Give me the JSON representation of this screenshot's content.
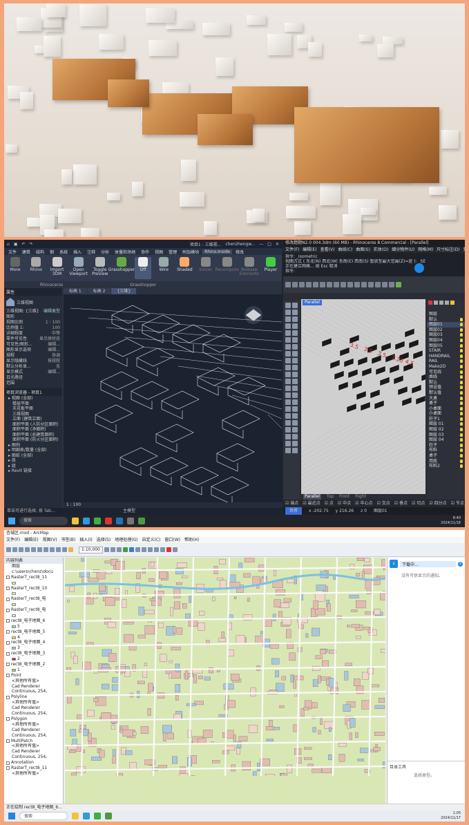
{
  "revit": {
    "menu": [
      "文件",
      "建筑",
      "结构",
      "钢",
      "系统",
      "插入",
      "注释",
      "分析",
      "体量和场地",
      "协作",
      "视图",
      "管理",
      "附加模块",
      "Rhino.Inside",
      "修改"
    ],
    "title": "项目1 - 三维视...",
    "user": "chenzhengw...",
    "ribbon_tabs": [
      "文件",
      "建筑",
      "结构",
      "钢",
      "系统",
      "插入",
      "注释",
      "分析",
      "体量和场地",
      "协作",
      "视图",
      "管理",
      "附加模块",
      "Rhino.Inside",
      "修改"
    ],
    "ribbon_buttons": [
      "More",
      "Rhino",
      "Import 3DM",
      "Open Viewport",
      "Toggle Preview",
      "Grasshopper",
      "Off",
      "Wire",
      "Shaded",
      "Solver",
      "Recompute",
      "Release Elements",
      "Player"
    ],
    "ribbon_groups": [
      "Rhinoceros",
      "Grasshopper"
    ],
    "properties_title": "属性",
    "view_type": "三维视图",
    "view_dropdown": "三维视图: {三维}",
    "edit_type": "编辑类型",
    "properties": [
      {
        "k": "图形",
        "v": ""
      },
      {
        "k": "视图比例",
        "v": "1 : 100"
      },
      {
        "k": "比例值 1:",
        "v": "100"
      },
      {
        "k": "详细程度",
        "v": "中等"
      },
      {
        "k": "零件可见性",
        "v": "显示原状态"
      },
      {
        "k": "可见性/图形...",
        "v": "编辑..."
      },
      {
        "k": "图形显示选项",
        "v": "编辑..."
      },
      {
        "k": "规程",
        "v": "协调"
      },
      {
        "k": "显示隐藏线",
        "v": "按规程"
      },
      {
        "k": "默认分析显...",
        "v": "无"
      },
      {
        "k": "显示模式",
        "v": "编辑..."
      },
      {
        "k": "日光路径",
        "v": ""
      },
      {
        "k": "范围",
        "v": ""
      }
    ],
    "browser_title": "项目浏览器 - 项目1",
    "browser": [
      {
        "t": "视图 (全部)",
        "l": 1
      },
      {
        "t": "楼层平面",
        "l": 2
      },
      {
        "t": "天花板平面",
        "l": 2
      },
      {
        "t": "三维视图",
        "l": 2
      },
      {
        "t": "立面 (建筑立面)",
        "l": 2
      },
      {
        "t": "面积平面 (人防分区面积)",
        "l": 2
      },
      {
        "t": "面积平面 (净面积)",
        "l": 2
      },
      {
        "t": "面积平面 (总建筑面积)",
        "l": 2
      },
      {
        "t": "面积平面 (防火分区面积)",
        "l": 2
      },
      {
        "t": "图例",
        "l": 1
      },
      {
        "t": "明细表/数量 (全部)",
        "l": 1
      },
      {
        "t": "图纸 (全部)",
        "l": 1
      },
      {
        "t": "族",
        "l": 1
      },
      {
        "t": "组",
        "l": 1
      },
      {
        "t": "Revit 链接",
        "l": 1
      }
    ],
    "view_tabs": [
      "标高 1",
      "标高 2",
      "{三维}"
    ],
    "scale": "1 : 100",
    "status": "单击可进行选择; 按 Tab...",
    "status_right": "主模型"
  },
  "rhino": {
    "title": "修改题题N2.0 004.3dm (60 MB) - Rhinoceros 8 Commercial - [Parallel]",
    "menu": [
      "文件(F)",
      "编辑(E)",
      "查看(V)",
      "曲线(C)",
      "曲面(S)",
      "实体(O)",
      "细分物件(U)",
      "网格(M)",
      "尺寸标注(D)",
      "变动(T)",
      "工具(L)",
      "分析(A)",
      "渲染(R)",
      "面板(P)",
      "说明(H)"
    ],
    "cmd_lines": [
      "指令: _Isometric",
      "视图方式 ( 东北(N) 西北(W) 东南(E) 西南(S) 暂放至最大范围(Z)=是 ): _SE",
      "正在建立网格... 按 Esc 取消",
      "指令:"
    ],
    "viewport": "Parallel",
    "viewport_tabs": [
      "Parallel",
      "Top",
      "Front",
      "Right"
    ],
    "annotations": [
      "3.5",
      "3.5",
      "3.5",
      "1.15",
      "4.5"
    ],
    "layers_title": "图层",
    "layers": [
      {
        "n": "默认",
        "sel": false
      },
      {
        "n": "图层01",
        "sel": true
      },
      {
        "n": "图层02",
        "sel": false
      },
      {
        "n": "图层03",
        "sel": false
      },
      {
        "n": "图层04",
        "sel": false
      },
      {
        "n": "图层05",
        "sel": false
      },
      {
        "n": "STAIR",
        "sel": false
      },
      {
        "n": "HANDRAIL",
        "sel": false
      },
      {
        "n": "RAIL",
        "sel": false
      },
      {
        "n": "Make2D",
        "sel": false
      },
      {
        "n": "可见线",
        "sel": false
      },
      {
        "n": "曲线",
        "sel": false
      },
      {
        "n": "默认",
        "sel": false
      },
      {
        "n": "预设值",
        "sel": false
      },
      {
        "n": "默认值",
        "sel": false
      },
      {
        "n": "大桌",
        "sel": false
      },
      {
        "n": "桌子",
        "sel": false
      },
      {
        "n": "小桌面",
        "sel": false
      },
      {
        "n": "小桌面",
        "sel": false
      },
      {
        "n": "柱子1",
        "sel": false
      },
      {
        "n": "图层 01",
        "sel": false
      },
      {
        "n": "图层 02",
        "sel": false
      },
      {
        "n": "图层 03",
        "sel": false
      },
      {
        "n": "图层 04",
        "sel": false
      },
      {
        "n": "柱子",
        "sel": false
      },
      {
        "n": "布料",
        "sel": false
      },
      {
        "n": "桌子",
        "sel": false
      },
      {
        "n": "用底",
        "sel": false
      },
      {
        "n": "布料2",
        "sel": false
      }
    ],
    "osnap": [
      "端点",
      "最近点",
      "点",
      "中点",
      "中心点",
      "交点",
      "垂点",
      "切点",
      "四分点",
      "节点",
      "顶点",
      "投影",
      "停用"
    ],
    "status": [
      "世界",
      "x -202.75",
      "y 216.26",
      "z 0",
      "图层01"
    ]
  },
  "taskbar_top": {
    "search": "搜索",
    "time": "8:40",
    "date": "2024/11/18"
  },
  "arcmap": {
    "title": "杏城区.mxd - ArcMap",
    "menu": [
      "文件(F)",
      "编辑(E)",
      "视图(V)",
      "书签(B)",
      "插入(I)",
      "选择(S)",
      "地理处理(G)",
      "自定义(C)",
      "窗口(W)",
      "帮助(H)"
    ],
    "scale": "1:10,000",
    "toc_title": "内容列表",
    "toc": [
      {
        "t": "图层",
        "cb": false,
        "sw": ""
      },
      {
        "t": "c:\\users\\chenz\\docu",
        "cb": false,
        "sw": ""
      },
      {
        "t": "RasterT_rect8_11",
        "cb": true,
        "sw": ""
      },
      {
        "t": "",
        "cb": false,
        "sw": "#f0e6a0"
      },
      {
        "t": "RasterT_rect8_10",
        "cb": true,
        "sw": ""
      },
      {
        "t": "",
        "cb": false,
        "sw": "#e9e9b0"
      },
      {
        "t": "RasterT_rect8_电",
        "cb": true,
        "sw": ""
      },
      {
        "t": "",
        "cb": false,
        "sw": "#f7d6c4"
      },
      {
        "t": "RasterT_rect8_电",
        "cb": true,
        "sw": ""
      },
      {
        "t": "",
        "cb": false,
        "sw": "#cfe6f2"
      },
      {
        "t": "rect8_电子地图_6",
        "cb": true,
        "sw": ""
      },
      {
        "t": "5",
        "cb": false,
        "sw": "#8fd0e8"
      },
      {
        "t": "rect8_电子地图_5",
        "cb": true,
        "sw": ""
      },
      {
        "t": "4",
        "cb": false,
        "sw": "#e6d24a"
      },
      {
        "t": "rect8_电子地图_4",
        "cb": true,
        "sw": ""
      },
      {
        "t": "3",
        "cb": false,
        "sw": "#a7c7e7"
      },
      {
        "t": "rect8_电子地图_3",
        "cb": true,
        "sw": ""
      },
      {
        "t": "2",
        "cb": false,
        "sw": "#c2195b"
      },
      {
        "t": "rect8_电子地图_2",
        "cb": true,
        "sw": ""
      },
      {
        "t": "1",
        "cb": false,
        "sw": "#9fd07a"
      },
      {
        "t": "Point",
        "cb": true,
        "sw": ""
      },
      {
        "t": "<其他所有值>",
        "cb": false,
        "sw": ""
      },
      {
        "t": "Cad Renderer",
        "cb": false,
        "sw": ""
      },
      {
        "t": "Continuous, 254,",
        "cb": false,
        "sw": ""
      },
      {
        "t": "Polyline",
        "cb": true,
        "sw": ""
      },
      {
        "t": "<其他所有值>",
        "cb": false,
        "sw": ""
      },
      {
        "t": "Cad Renderer",
        "cb": false,
        "sw": ""
      },
      {
        "t": "Continuous, 254,",
        "cb": false,
        "sw": ""
      },
      {
        "t": "Polygon",
        "cb": true,
        "sw": ""
      },
      {
        "t": "<其他所有值>",
        "cb": false,
        "sw": ""
      },
      {
        "t": "Cad Renderer",
        "cb": false,
        "sw": ""
      },
      {
        "t": "Continuous, 254,",
        "cb": false,
        "sw": ""
      },
      {
        "t": "MultiPatch",
        "cb": true,
        "sw": ""
      },
      {
        "t": "<其他所有值>",
        "cb": false,
        "sw": ""
      },
      {
        "t": "Cad Renderer",
        "cb": false,
        "sw": ""
      },
      {
        "t": "Continuous, 254,",
        "cb": false,
        "sw": ""
      },
      {
        "t": "Annotation",
        "cb": true,
        "sw": ""
      },
      {
        "t": "RasterT_rect8_11",
        "cb": true,
        "sw": ""
      },
      {
        "t": "<其他所有值>",
        "cb": false,
        "sw": ""
      }
    ],
    "right_panel": {
      "tab": "下载中...",
      "badge": "2",
      "msg": "没有可供显示的通知。",
      "tool_title": "目录工具",
      "tool_msg": "选择类型。"
    },
    "status": "正在绘制 rect8_电子地图_6..."
  },
  "taskbar_bottom": {
    "search": "搜索",
    "time": "1:05",
    "date": "2024/11/17"
  }
}
